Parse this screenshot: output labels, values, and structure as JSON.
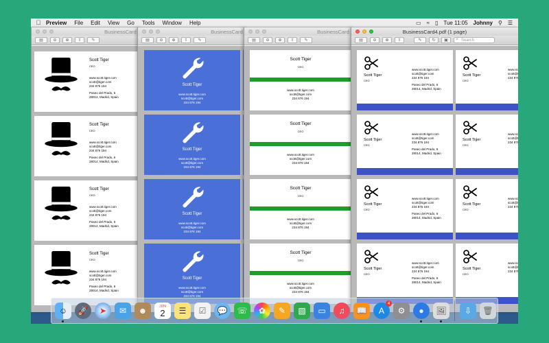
{
  "menubar": {
    "apple": "",
    "items": [
      "Preview",
      "File",
      "Edit",
      "View",
      "Go",
      "Tools",
      "Window",
      "Help"
    ],
    "clock": "Tue 11:05",
    "user": "Johnny"
  },
  "windows": [
    {
      "title": "BusinessCard"
    },
    {
      "title": "BusinessCard"
    },
    {
      "title": "BusinessCard"
    },
    {
      "title": "BusinessCard4.pdf (1 page)"
    }
  ],
  "toolbar": {
    "search_placeholder": "Search"
  },
  "card": {
    "name": "Scott Tiger",
    "role": "CEO",
    "website": "www.scott.tiger.com",
    "email": "scott@tiger.com",
    "phone": "234 876 194",
    "address_line1": "Paseo del Prado, 6",
    "address_line2": "28014, Madrid, Spain"
  },
  "colors": {
    "blue_card": "#4a6fd6",
    "green_bar": "#1f9d2b",
    "indigo_bar": "#3e52c8"
  },
  "dock": {
    "calendar_month": "JUN",
    "calendar_day": "2",
    "appstore_badge": "4",
    "icons": [
      "finder-icon",
      "launchpad-icon",
      "safari-icon",
      "mail-icon",
      "contacts-icon",
      "calendar-icon",
      "notes-icon",
      "reminders-icon",
      "messages-icon",
      "facetime-icon",
      "photos-icon",
      "pages-icon",
      "numbers-icon",
      "keynote-icon",
      "music-icon",
      "books-icon",
      "appstore-icon",
      "system-preferences-icon",
      "gamecenter-icon",
      "preview-icon",
      "downloads-icon",
      "trash-icon"
    ]
  }
}
